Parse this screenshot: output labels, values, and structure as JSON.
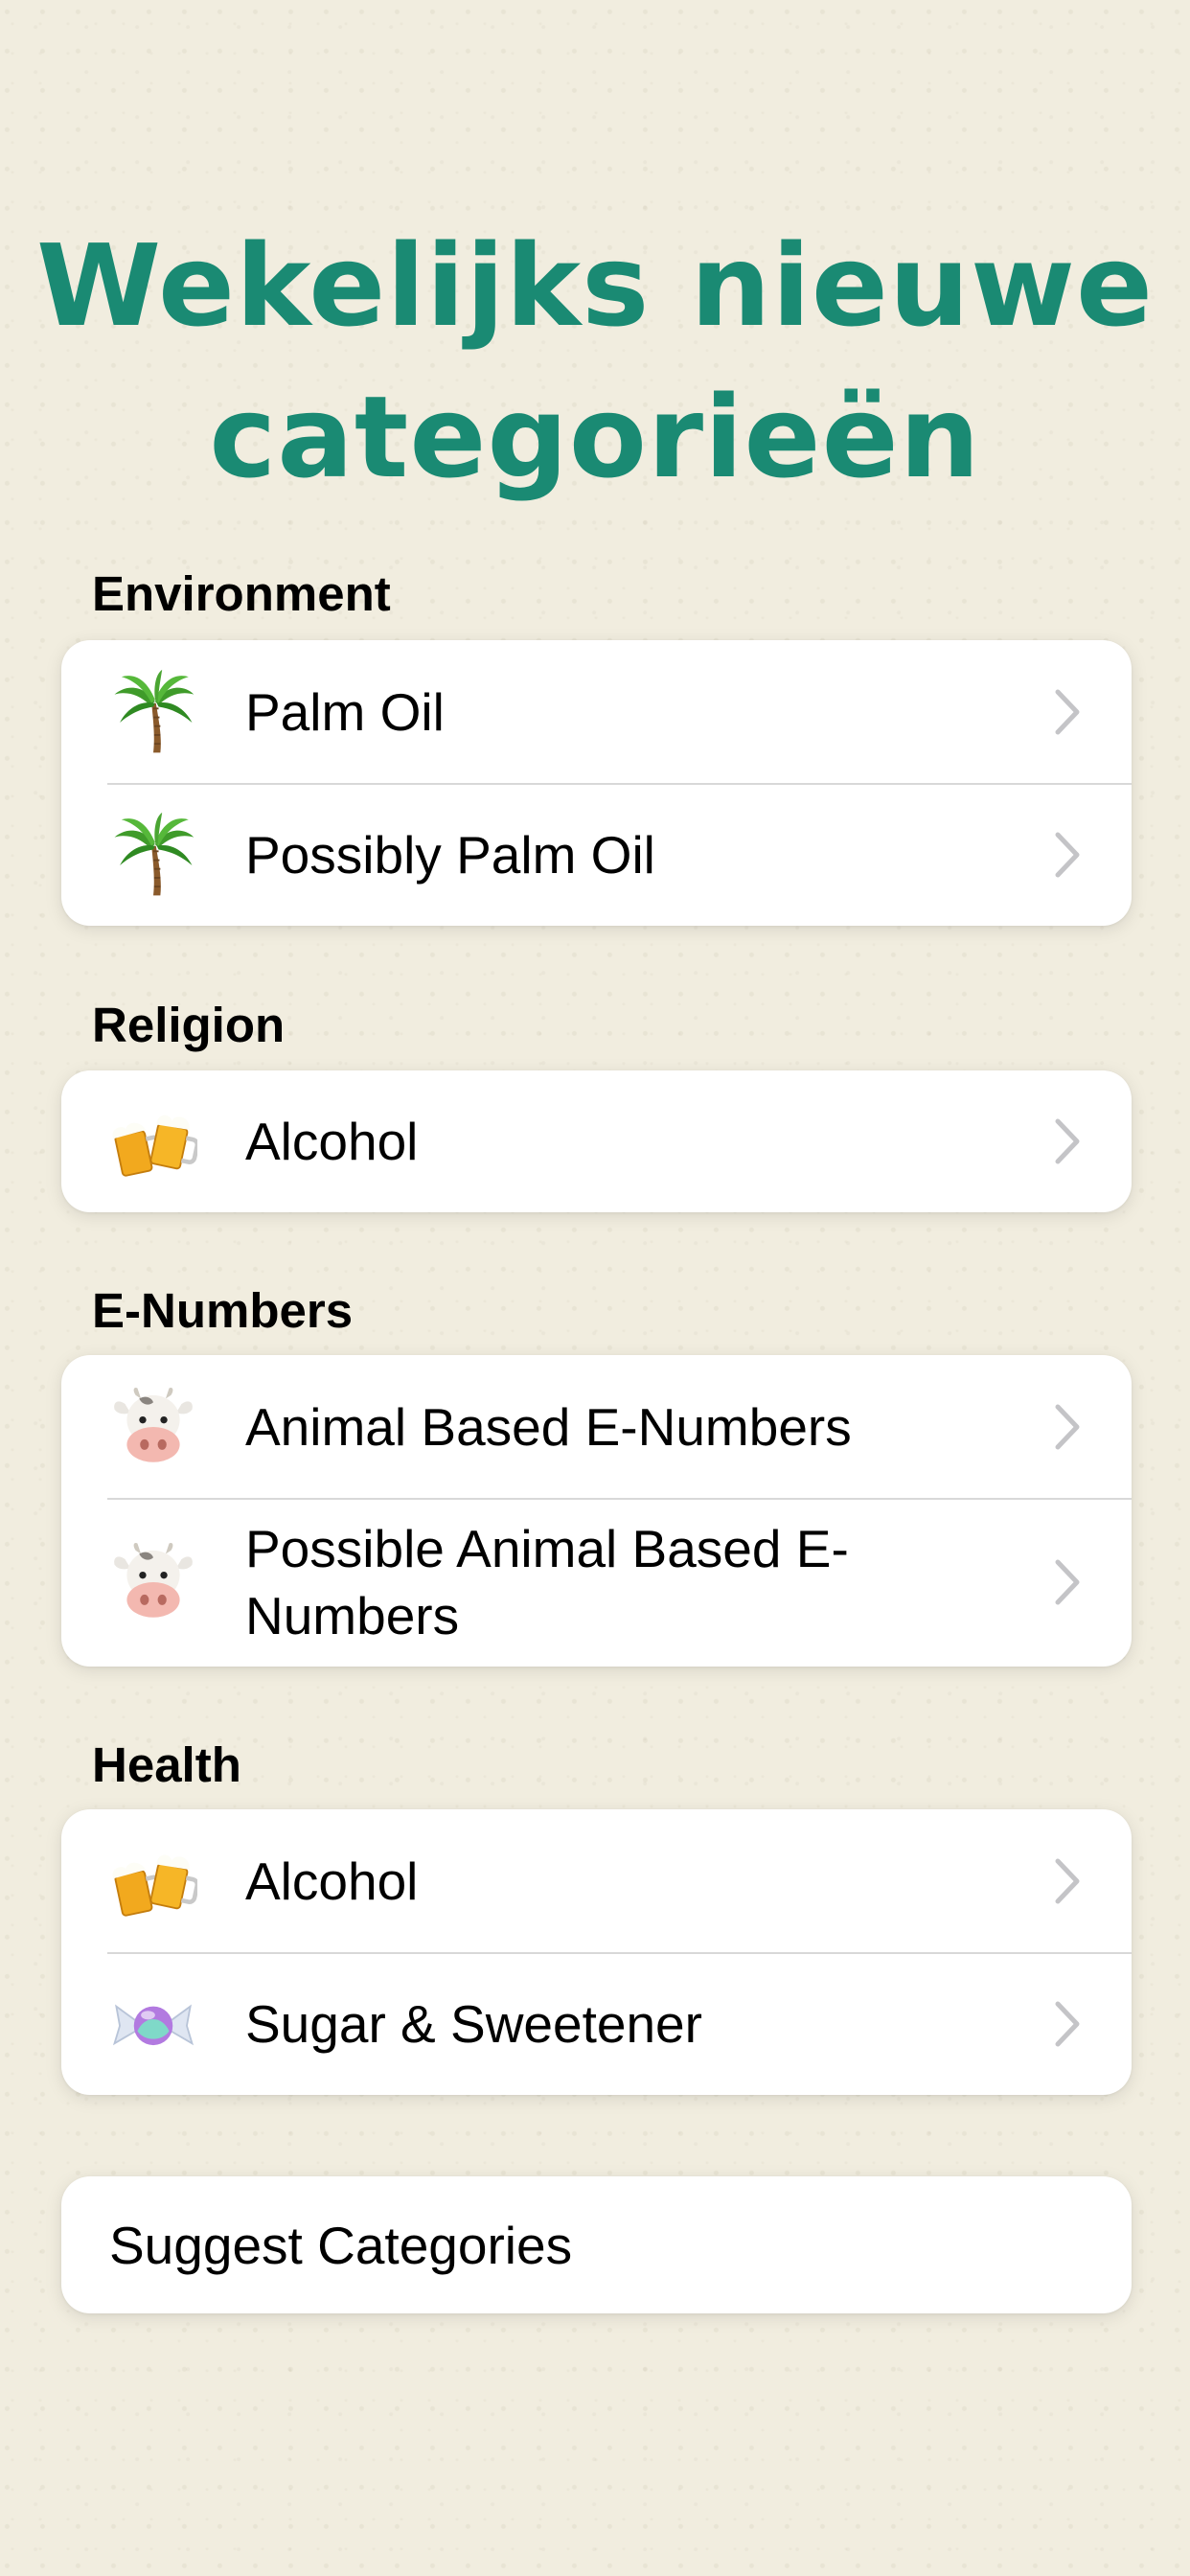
{
  "headline": {
    "line1": "Wekelijks nieuwe",
    "line2": "categorieën"
  },
  "sections": [
    {
      "header": "Environment",
      "items": [
        {
          "label": "Palm Oil",
          "icon": "palm-tree-icon"
        },
        {
          "label": "Possibly Palm Oil",
          "icon": "palm-tree-icon"
        }
      ]
    },
    {
      "header": "Religion",
      "items": [
        {
          "label": "Alcohol",
          "icon": "beer-mugs-icon"
        }
      ]
    },
    {
      "header": "E-Numbers",
      "items": [
        {
          "label": "Animal Based E-Numbers",
          "icon": "cow-face-icon"
        },
        {
          "label": "Possible Animal Based E-Numbers",
          "icon": "cow-face-icon"
        }
      ]
    },
    {
      "header": "Health",
      "items": [
        {
          "label": "Alcohol",
          "icon": "beer-mugs-icon"
        },
        {
          "label": "Sugar & Sweetener",
          "icon": "candy-icon"
        }
      ]
    }
  ],
  "suggest": {
    "label": "Suggest Categories"
  },
  "colors": {
    "accent": "#1a8a73",
    "background": "#f1eddf",
    "card": "#ffffff",
    "chevron": "#c4c4c7",
    "separator": "#d8d8d8"
  }
}
